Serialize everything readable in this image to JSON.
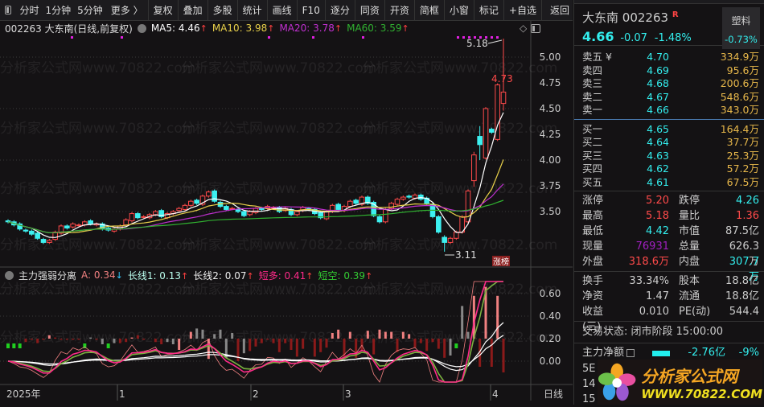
{
  "toolbar": {
    "items": [
      "分时",
      "1分钟",
      "5分钟",
      "更多 〉",
      "复权",
      "叠加",
      "多股",
      "统计",
      "画线",
      "F10",
      "逐分",
      "同资",
      "开资",
      "简框",
      "小窗",
      "标记",
      "+自选",
      "返回"
    ]
  },
  "legend": {
    "title": "002263 大东南(日线,前复权)",
    "ma5": "MA5: 4.46",
    "ma10": "MA10: 3.98",
    "ma20": "MA20: 3.78",
    "ma60": "MA60: 3.59",
    "arrow_up": "↑"
  },
  "sublegend": {
    "title": "主力强弱分离",
    "a": "A: 0.34",
    "a_arrow": "↓",
    "l1": "长线1: 0.13",
    "l2": "长线2: 0.07",
    "dd": "短多: 0.41",
    "dk": "短空: 0.39",
    "arrow_up": "↑"
  },
  "annotations": {
    "high": "5.18",
    "last_high": "4.73",
    "low": "3.11",
    "badge": "涨榜"
  },
  "price_axis": [
    "5.00",
    "4.75",
    "4.50",
    "4.25",
    "4.00",
    "3.75",
    "3.50"
  ],
  "sub_axis": [
    "0.60",
    "0.40",
    "0.20",
    "0.00"
  ],
  "time_axis": [
    "2025年",
    "1",
    "2",
    "3",
    "4"
  ],
  "period": "日线",
  "colors": {
    "up": "#ff4a4a",
    "down": "#3df0f0",
    "ma5": "#ffffff",
    "ma10": "#e8d04a",
    "ma20": "#c030d0",
    "ma60": "#30b030",
    "bg": "#141214"
  },
  "chart_data": {
    "type": "candlestick",
    "price_range": [
      3.0,
      5.3
    ],
    "close": [
      3.4,
      3.37,
      3.33,
      3.31,
      3.28,
      3.24,
      3.2,
      3.22,
      3.3,
      3.36,
      3.34,
      3.38,
      3.37,
      3.4,
      3.38,
      3.38,
      3.33,
      3.32,
      3.33,
      3.36,
      3.42,
      3.48,
      3.44,
      3.45,
      3.47,
      3.5,
      3.45,
      3.48,
      3.5,
      3.53,
      3.56,
      3.6,
      3.58,
      3.65,
      3.69,
      3.6,
      3.55,
      3.52,
      3.53,
      3.5,
      3.46,
      3.5,
      3.53,
      3.52,
      3.55,
      3.54,
      3.5,
      3.53,
      3.47,
      3.5,
      3.54,
      3.52,
      3.48,
      3.44,
      3.5,
      3.56,
      3.52,
      3.55,
      3.6,
      3.58,
      3.64,
      3.58,
      3.46,
      3.4,
      3.52,
      3.58,
      3.62,
      3.64,
      3.64,
      3.66,
      3.62,
      3.58,
      3.45,
      3.3,
      3.2,
      3.24,
      3.3,
      3.45,
      3.7,
      4.05,
      4.15,
      4.5,
      4.27,
      4.73,
      4.66
    ],
    "open_overrides": {
      "74": 3.25,
      "75": 3.2,
      "76": 3.24,
      "77": 3.3,
      "78": 3.4,
      "79": 3.8,
      "80": 4.23,
      "81": 4.02,
      "82": 4.3,
      "83": 4.2,
      "84": 4.55
    },
    "high_low_overrides": {
      "74": [
        3.27,
        3.11
      ],
      "79": [
        4.08,
        3.74
      ],
      "80": [
        4.33,
        4.0
      ],
      "84": [
        5.18,
        4.48
      ]
    },
    "sub_bars": [
      0.17,
      0.17,
      0.17,
      0.17,
      0.19,
      0.16,
      0.19,
      0.23,
      0.21,
      0.19,
      0.19,
      0.19,
      0.19,
      0.19,
      0.21,
      0.19,
      0.15,
      0.17,
      0.16,
      0.16,
      0.17,
      0.21,
      0.23,
      0.19,
      0.2,
      0.17,
      0.15,
      0.17,
      0.15,
      0.1,
      0.2,
      0.26,
      0.29,
      0.28,
      0.02,
      0.24,
      0.28,
      0.03,
      0.25,
      0.0,
      0.07,
      0.09,
      0.13,
      0.16,
      0.19,
      0.16,
      0.08,
      0.16,
      0.1,
      0.04,
      0.11,
      0.2,
      0.04,
      0.08,
      0.12,
      0.25,
      0.28,
      0.02,
      0.26,
      0.03,
      0.1,
      0.27,
      0.06,
      0.28,
      0.26,
      0.26,
      0.08,
      0.26,
      0.24,
      0.12,
      0.16,
      0.09,
      0.17,
      0.11,
      0.03,
      0.05,
      0.12,
      0.49,
      0.26,
      0.58,
      -0.05,
      0.66,
      -0.05,
      0.58,
      -0.1
    ],
    "sub_bar_kinds": "gggrrrrprrrrrgsrsgsrrprrrrrsspppsspssssrsrrrrrrrrrrprrrpprprrprppprpprrrrrrsgssprprpr",
    "sub_range": [
      -0.2,
      0.7
    ]
  },
  "quote": {
    "name": "大东南",
    "code": "002263",
    "flag": "R",
    "price": "4.66",
    "change": "-0.07",
    "pct": "-1.48%",
    "sector": "塑料",
    "sector_pct": "-0.73%"
  },
  "asks": [
    {
      "l": "卖五 ¥",
      "p": "4.70",
      "v": "334.9万"
    },
    {
      "l": "卖四",
      "p": "4.69",
      "v": "95.6万"
    },
    {
      "l": "卖三",
      "p": "4.68",
      "v": "200.6万"
    },
    {
      "l": "卖二",
      "p": "4.67",
      "v": "548.6万"
    },
    {
      "l": "卖一",
      "p": "4.66",
      "v": "343.0万"
    }
  ],
  "bids": [
    {
      "l": "买一",
      "p": "4.65",
      "v": "164.4万"
    },
    {
      "l": "买二",
      "p": "4.64",
      "v": "37.7万"
    },
    {
      "l": "买三",
      "p": "4.63",
      "v": "25.3万"
    },
    {
      "l": "买四",
      "p": "4.62",
      "v": "57.2万"
    },
    {
      "l": "买五",
      "p": "4.61",
      "v": "67.5万"
    }
  ],
  "stats": [
    {
      "l": "涨停",
      "v": "5.20",
      "c": "#ff4a4a",
      "l2": "跌停",
      "v2": "4.26",
      "c2": "#3ee"
    },
    {
      "l": "最高",
      "v": "5.18",
      "c": "#ff4a4a",
      "l2": "量比",
      "v2": "1.36",
      "c2": "#ff4a4a"
    },
    {
      "l": "最低",
      "v": "4.42",
      "c": "#3ee",
      "l2": "市值",
      "v2": "87.5亿",
      "c2": "#ccc"
    },
    {
      "l": "现量",
      "v": "76931",
      "c": "#a020c0",
      "l2": "总量",
      "v2": "626.3万",
      "c2": "#ccc"
    },
    {
      "l": "外盘",
      "v": "318.6万",
      "c": "#ff4a4a",
      "l2": "内盘",
      "v2": "307.7万",
      "c2": "#3ee"
    }
  ],
  "stats2": [
    {
      "l": "换手",
      "v": "33.34%",
      "l2": "股本",
      "v2": "18.8亿"
    },
    {
      "l": "净资",
      "v": "1.47",
      "l2": "流通",
      "v2": "18.8亿"
    },
    {
      "l": "收益(三)",
      "v": "0.010",
      "l2": "PE(动)",
      "v2": "544.4"
    }
  ],
  "status": "交易状态: 闭市阶段 15:00:00",
  "flow": {
    "label": "主力净额",
    "value": "-2.76亿",
    "pct": "-9%"
  },
  "partial_rows": [
    "5E",
    "14",
    "15"
  ],
  "logo": {
    "cn": "分析家公式网",
    "url": "WWW.70822.COM"
  },
  "watermark": "分析家公式网www.70822.com"
}
